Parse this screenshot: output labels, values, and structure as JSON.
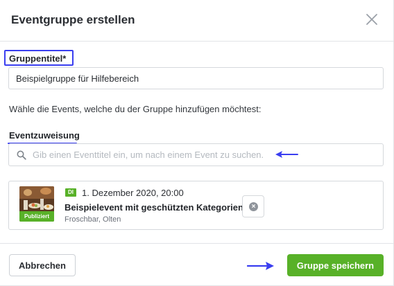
{
  "dialog": {
    "title": "Eventgruppe erstellen"
  },
  "form": {
    "group_title_label": "Gruppentitel*",
    "group_title_value": "Beispielgruppe für Hilfebereich",
    "help_text": "Wähle die Events, welche du der Gruppe hinzufügen möchtest:",
    "assignment_label": "Eventzuweisung",
    "search_placeholder": "Gib einen Eventtitel ein, um nach einem Event zu suchen."
  },
  "event": {
    "status": "Publiziert",
    "day": "DI",
    "date": "1. Dezember 2020, 20:00",
    "title": "Beispielevent mit geschützten Kategorien",
    "venue": "Froschbar, Olten"
  },
  "footer": {
    "cancel_label": "Abbrechen",
    "save_label": "Gruppe speichern"
  },
  "colors": {
    "accent_green": "#58b128",
    "annotation_blue": "#3a3ef0"
  }
}
